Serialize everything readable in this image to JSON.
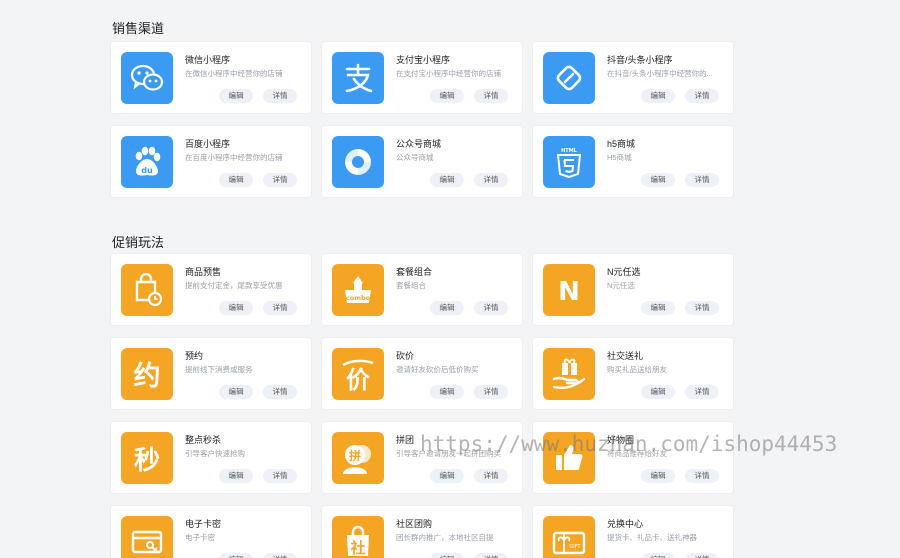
{
  "colors": {
    "blue": "#3b9bf3",
    "orange": "#f5a524",
    "page_bg": "#f3f4f6"
  },
  "sections": [
    {
      "title": "销售渠道",
      "cards": [
        {
          "title": "微信小程序",
          "desc": "在微信小程序中经营你的店铺",
          "icon": "wechat-icon",
          "color": "blue",
          "edit": "编辑",
          "detail": "详情"
        },
        {
          "title": "支付宝小程序",
          "desc": "在支付宝小程序中经营你的店铺",
          "icon": "alipay-icon",
          "color": "blue",
          "edit": "编辑",
          "detail": "详情"
        },
        {
          "title": "抖音/头条小程序",
          "desc": "在抖音/头条小程序中经营你的...",
          "icon": "douyin-link-icon",
          "color": "blue",
          "edit": "编辑",
          "detail": "详情"
        },
        {
          "title": "百度小程序",
          "desc": "在百度小程序中经营你的店铺",
          "icon": "baidu-paw-icon",
          "color": "blue",
          "edit": "编辑",
          "detail": "详情"
        },
        {
          "title": "公众号商城",
          "desc": "公众号商城",
          "icon": "swirl-icon",
          "color": "blue",
          "edit": "编辑",
          "detail": "详情"
        },
        {
          "title": "h5商城",
          "desc": "H5商城",
          "icon": "html5-icon",
          "color": "blue",
          "edit": "编辑",
          "detail": "详情"
        }
      ]
    },
    {
      "title": "促销玩法",
      "cards": [
        {
          "title": "商品预售",
          "desc": "提前支付定金，尾款享受优惠",
          "icon": "presale-bag-icon",
          "color": "orange",
          "edit": "编辑",
          "detail": "详情"
        },
        {
          "title": "套餐组合",
          "desc": "套餐组合",
          "icon": "combo-icon",
          "color": "orange",
          "edit": "编辑",
          "detail": "详情"
        },
        {
          "title": "N元任选",
          "desc": "N元任选",
          "icon": "letter-n-icon",
          "color": "orange",
          "edit": "编辑",
          "detail": "详情"
        },
        {
          "title": "预约",
          "desc": "提前线下消费或服务",
          "icon": "yue-char-icon",
          "color": "orange",
          "edit": "编辑",
          "detail": "详情"
        },
        {
          "title": "砍价",
          "desc": "邀请好友砍价后低价购买",
          "icon": "kan-char-icon",
          "color": "orange",
          "edit": "编辑",
          "detail": "详情"
        },
        {
          "title": "社交送礼",
          "desc": "购买礼品送给朋友",
          "icon": "gift-hand-icon",
          "color": "orange",
          "edit": "编辑",
          "detail": "详情"
        },
        {
          "title": "整点秒杀",
          "desc": "引导客户快速抢购",
          "icon": "miao-char-icon",
          "color": "orange",
          "edit": "编辑",
          "detail": "详情"
        },
        {
          "title": "拼团",
          "desc": "引导客户邀请朋友一起拼团购买",
          "icon": "pin-group-icon",
          "color": "orange",
          "edit": "编辑",
          "detail": "详情"
        },
        {
          "title": "好物圈",
          "desc": "将商品推荐给好友",
          "icon": "thumbs-up-icon",
          "color": "orange",
          "edit": "编辑",
          "detail": "详情"
        },
        {
          "title": "电子卡密",
          "desc": "电子卡密",
          "icon": "card-key-icon",
          "color": "orange",
          "edit": "编辑",
          "detail": "详情"
        },
        {
          "title": "社区团购",
          "desc": "团长群内推广，本地社区自提",
          "icon": "she-bag-icon",
          "color": "orange",
          "edit": "编辑",
          "detail": "详情"
        },
        {
          "title": "兑换中心",
          "desc": "提货卡、礼品卡、送礼神器",
          "icon": "gift-card-icon",
          "color": "orange",
          "edit": "编辑",
          "detail": "详情"
        }
      ]
    }
  ],
  "watermark": "https://www.huzhan.com/ishop44453"
}
